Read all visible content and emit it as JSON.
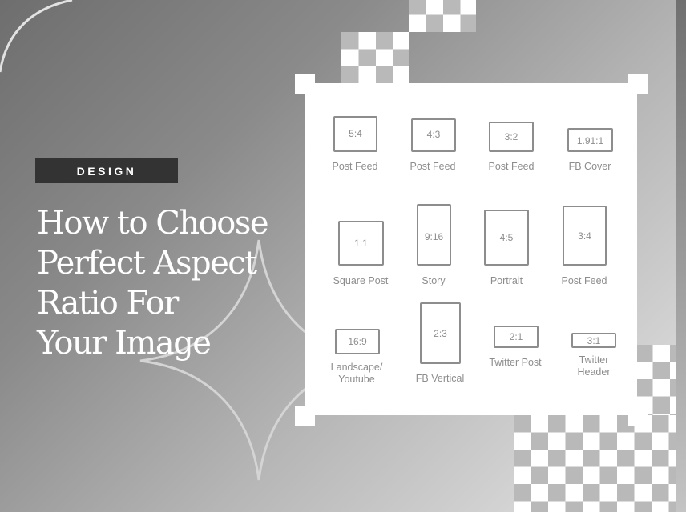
{
  "badge": {
    "label": "DESIGN"
  },
  "title": {
    "lines": [
      "How to Choose",
      "Perfect Aspect",
      "Ratio For",
      "Your Image"
    ]
  },
  "aspect_ratios": [
    {
      "ratio": "5:4",
      "label": "Post Feed"
    },
    {
      "ratio": "4:3",
      "label": "Post Feed"
    },
    {
      "ratio": "3:2",
      "label": "Post Feed"
    },
    {
      "ratio": "1.91:1",
      "label": "FB Cover"
    },
    {
      "ratio": "1:1",
      "label": "Square Post"
    },
    {
      "ratio": "9:16",
      "label": "Story"
    },
    {
      "ratio": "4:5",
      "label": "Portrait"
    },
    {
      "ratio": "3:4",
      "label": "Post Feed"
    },
    {
      "ratio": "16:9",
      "label_line1": "Landscape/",
      "label_line2": "Youtube"
    },
    {
      "ratio": "2:3",
      "label": "FB Vertical"
    },
    {
      "ratio": "2:1",
      "label": "Twitter Post"
    },
    {
      "ratio": "3:1",
      "label_line1": "Twitter",
      "label_line2": "Header"
    }
  ],
  "colors": {
    "badge_bg": "#333333",
    "outline_gray": "#8d8d8d",
    "checker_gray": "#b9b9b9"
  }
}
